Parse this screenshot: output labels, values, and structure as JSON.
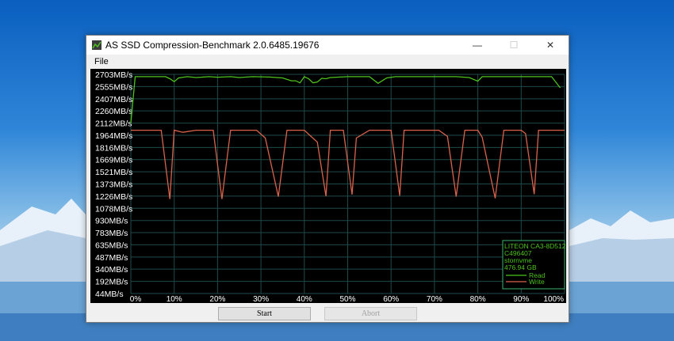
{
  "window": {
    "title": "AS SSD Compression-Benchmark 2.0.6485.19676",
    "minimize": "—",
    "maximize": "☐",
    "close": "✕"
  },
  "menu": {
    "file": "File"
  },
  "chart_data": {
    "type": "line",
    "title": "",
    "ylabel": "",
    "xlabel": "",
    "ylim": [
      44,
      2703
    ],
    "xlim": [
      0,
      100
    ],
    "grid": true,
    "y_ticks": [
      "2703MB/s",
      "2555MB/s",
      "2407MB/s",
      "2260MB/s",
      "2112MB/s",
      "1964MB/s",
      "1816MB/s",
      "1669MB/s",
      "1521MB/s",
      "1373MB/s",
      "1226MB/s",
      "1078MB/s",
      "930MB/s",
      "783MB/s",
      "635MB/s",
      "487MB/s",
      "340MB/s",
      "192MB/s",
      "44MB/s"
    ],
    "y_tick_values": [
      2703,
      2555,
      2407,
      2260,
      2112,
      1964,
      1816,
      1669,
      1521,
      1373,
      1226,
      1078,
      930,
      783,
      635,
      487,
      340,
      192,
      44
    ],
    "x_ticks": [
      "0%",
      "10%",
      "20%",
      "30%",
      "40%",
      "50%",
      "60%",
      "70%",
      "80%",
      "90%",
      "100%"
    ],
    "x_tick_values": [
      0,
      10,
      20,
      30,
      40,
      50,
      60,
      70,
      80,
      90,
      100
    ],
    "legend": {
      "position": "bottom-right",
      "lines": [
        "LITEON CA3-8D512",
        "C496407",
        "stornvme",
        "476.94 GB"
      ],
      "entries": [
        "Read",
        "Write"
      ]
    },
    "series": [
      {
        "name": "Read",
        "color": "#4ec21e",
        "points": [
          [
            0,
            2112
          ],
          [
            1,
            2675
          ],
          [
            8,
            2675
          ],
          [
            9,
            2650
          ],
          [
            10,
            2615
          ],
          [
            11,
            2660
          ],
          [
            13,
            2675
          ],
          [
            15,
            2665
          ],
          [
            18,
            2675
          ],
          [
            20,
            2668
          ],
          [
            23,
            2675
          ],
          [
            25,
            2665
          ],
          [
            28,
            2675
          ],
          [
            32,
            2670
          ],
          [
            35,
            2660
          ],
          [
            37,
            2625
          ],
          [
            38,
            2625
          ],
          [
            39,
            2600
          ],
          [
            40,
            2675
          ],
          [
            41,
            2650
          ],
          [
            42,
            2600
          ],
          [
            43,
            2610
          ],
          [
            44,
            2655
          ],
          [
            45,
            2650
          ],
          [
            46,
            2665
          ],
          [
            50,
            2675
          ],
          [
            55,
            2675
          ],
          [
            57,
            2595
          ],
          [
            59,
            2660
          ],
          [
            61,
            2675
          ],
          [
            65,
            2675
          ],
          [
            70,
            2675
          ],
          [
            75,
            2675
          ],
          [
            78,
            2665
          ],
          [
            80,
            2620
          ],
          [
            81,
            2675
          ],
          [
            85,
            2675
          ],
          [
            90,
            2675
          ],
          [
            94,
            2675
          ],
          [
            97,
            2675
          ],
          [
            99,
            2540
          ]
        ]
      },
      {
        "name": "Write",
        "color": "#d9634c",
        "points": [
          [
            0,
            2025
          ],
          [
            6,
            2025
          ],
          [
            7,
            2025
          ],
          [
            9,
            1190
          ],
          [
            10,
            2025
          ],
          [
            12,
            2000
          ],
          [
            15,
            2025
          ],
          [
            19,
            2025
          ],
          [
            21,
            1190
          ],
          [
            23,
            2025
          ],
          [
            26,
            2025
          ],
          [
            29,
            2025
          ],
          [
            31,
            1930
          ],
          [
            34,
            1220
          ],
          [
            36,
            2025
          ],
          [
            40,
            2025
          ],
          [
            43,
            1880
          ],
          [
            45,
            1225
          ],
          [
            46,
            2025
          ],
          [
            49,
            2025
          ],
          [
            51,
            1245
          ],
          [
            52,
            1930
          ],
          [
            55,
            2025
          ],
          [
            60,
            2025
          ],
          [
            62,
            1230
          ],
          [
            63,
            2025
          ],
          [
            67,
            2025
          ],
          [
            71,
            2025
          ],
          [
            73,
            1950
          ],
          [
            75,
            1220
          ],
          [
            77,
            2025
          ],
          [
            80,
            2025
          ],
          [
            81,
            1940
          ],
          [
            84,
            1200
          ],
          [
            86,
            2025
          ],
          [
            90,
            2025
          ],
          [
            91,
            1985
          ],
          [
            93,
            1250
          ],
          [
            94,
            2025
          ],
          [
            100,
            2025
          ]
        ]
      }
    ]
  },
  "buttons": {
    "start": "Start",
    "abort": "Abort"
  }
}
